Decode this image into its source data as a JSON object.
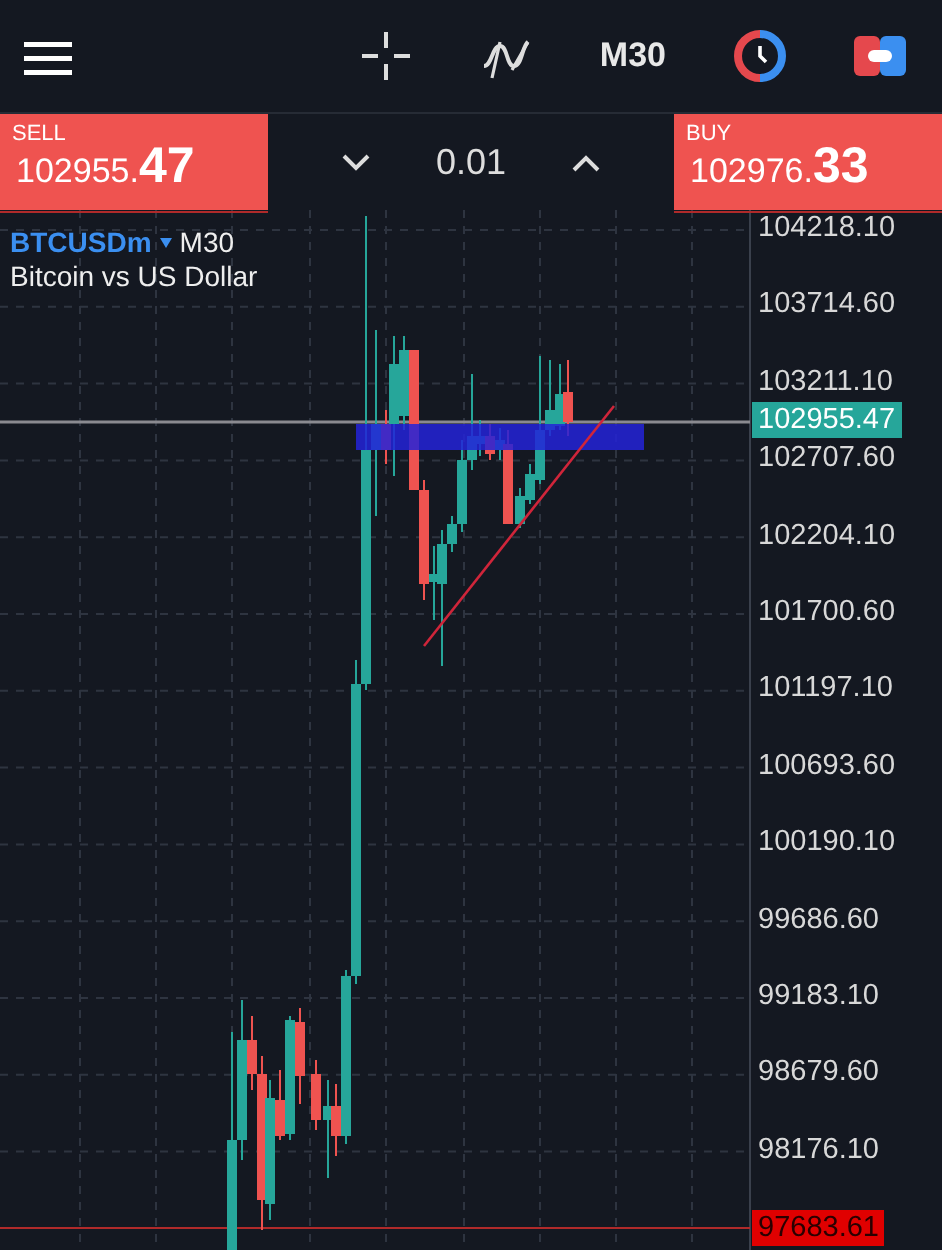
{
  "toolbar": {
    "timeframe": "M30"
  },
  "trade_panel": {
    "sell": {
      "label": "SELL",
      "price_main": "102955.",
      "price_big": "47"
    },
    "volume": "0.01",
    "buy": {
      "label": "BUY",
      "price_main": "102976.",
      "price_big": "33"
    }
  },
  "chart": {
    "symbol": "BTCUSDm",
    "timeframe": "M30",
    "description": "Bitcoin vs US Dollar",
    "price_ticks": [
      "104218.10",
      "103714.60",
      "103211.10",
      "102707.60",
      "102204.10",
      "101700.60",
      "101197.10",
      "100693.60",
      "100190.10",
      "99686.60",
      "99183.10",
      "98679.60",
      "98176.10"
    ],
    "current_price": "102955.47",
    "low_marker": "97683.61"
  }
}
